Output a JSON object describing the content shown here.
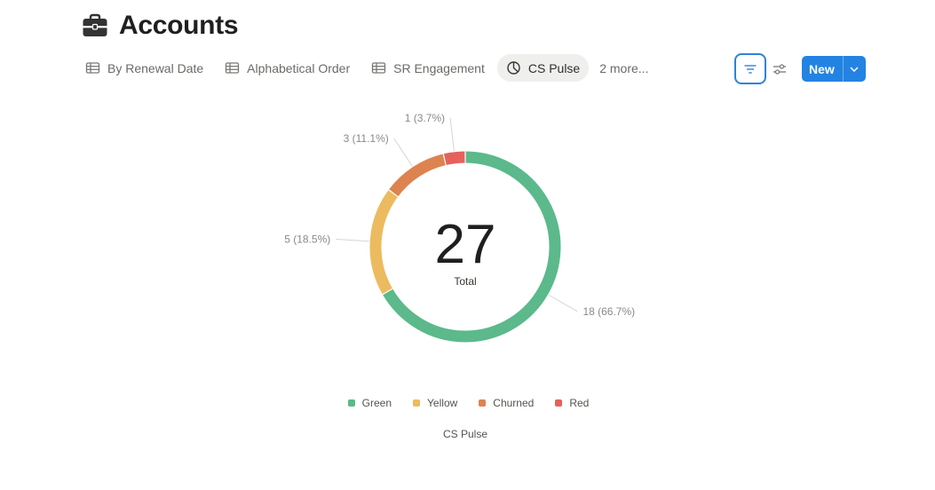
{
  "page": {
    "title": "Accounts",
    "icon": "briefcase-icon"
  },
  "tabs": [
    {
      "label": "By Renewal Date",
      "icon": "table-icon",
      "active": false
    },
    {
      "label": "Alphabetical Order",
      "icon": "table-icon",
      "active": false
    },
    {
      "label": "SR Engagement",
      "icon": "table-icon",
      "active": false
    },
    {
      "label": "CS Pulse",
      "icon": "pie-chart-icon",
      "active": true
    }
  ],
  "more_tabs_label": "2 more...",
  "toolbar": {
    "new_label": "New",
    "filter_icon": "filter-icon",
    "settings_icon": "sliders-icon",
    "caret_icon": "chevron-down-icon"
  },
  "colors": {
    "accent": "#2383e2",
    "Green": "#5bb98b",
    "Yellow": "#ecbb5f",
    "Churned": "#dd8350",
    "Red": "#e5615c"
  },
  "chart_data": {
    "type": "pie",
    "donut": true,
    "total": 27,
    "total_label": "Total",
    "caption": "CS Pulse",
    "legend_position": "bottom",
    "slices": [
      {
        "name": "Green",
        "value": 18,
        "label": "18 (66.7%)",
        "color": "#5bb98b"
      },
      {
        "name": "Yellow",
        "value": 5,
        "label": "5 (18.5%)",
        "color": "#ecbb5f"
      },
      {
        "name": "Churned",
        "value": 3,
        "label": "3 (11.1%)",
        "color": "#dd8350"
      },
      {
        "name": "Red",
        "value": 1,
        "label": "1 (3.7%)",
        "color": "#e5615c"
      }
    ]
  }
}
